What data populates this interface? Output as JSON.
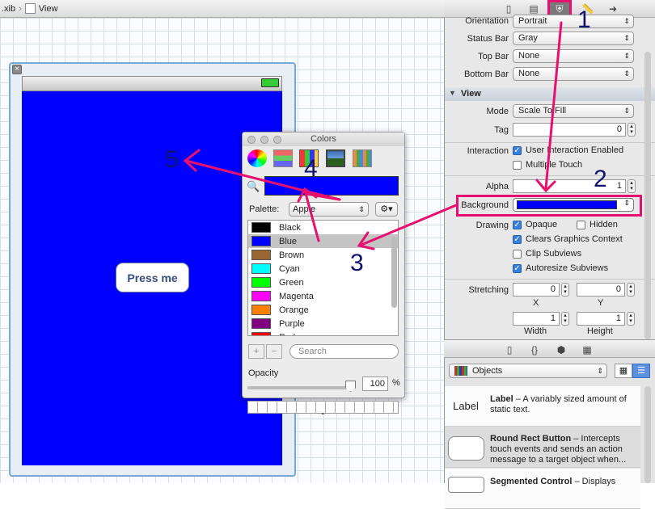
{
  "jumpbar": {
    "file": ".xib",
    "sep": "›",
    "view": "View"
  },
  "canvas": {
    "button_label": "Press me",
    "view_color": "#0000ff",
    "close_glyph": "×"
  },
  "colors_panel": {
    "title": "Colors",
    "palette_label": "Palette:",
    "palette_value": "Apple",
    "selected_color": "#0000ff",
    "colors": [
      {
        "name": "Black",
        "hex": "#000000"
      },
      {
        "name": "Blue",
        "hex": "#0000ff",
        "selected": true
      },
      {
        "name": "Brown",
        "hex": "#996633"
      },
      {
        "name": "Cyan",
        "hex": "#00ffff"
      },
      {
        "name": "Green",
        "hex": "#00ff00"
      },
      {
        "name": "Magenta",
        "hex": "#ff00ff"
      },
      {
        "name": "Orange",
        "hex": "#ff8000"
      },
      {
        "name": "Purple",
        "hex": "#800080"
      },
      {
        "name": "Red",
        "hex": "#ff0000"
      }
    ],
    "search_placeholder": "Search",
    "add_glyph": "+",
    "remove_glyph": "−",
    "opacity_label": "Opacity",
    "opacity_value": "100",
    "opacity_unit": "%",
    "opacity_fraction": 1.0,
    "gear_glyph": "⚙▾",
    "handle_glyph": "⌃"
  },
  "inspector": {
    "tab_icons": [
      "file-icon",
      "quick-help-icon",
      "identity-icon",
      "attributes-icon",
      "size-icon",
      "connections-icon"
    ],
    "orientation_label": "Orientation",
    "orientation_value": "Portrait",
    "statusbar_label": "Status Bar",
    "statusbar_value": "Gray",
    "topbar_label": "Top Bar",
    "topbar_value": "None",
    "bottombar_label": "Bottom Bar",
    "bottombar_value": "None",
    "view_section": "View",
    "mode_label": "Mode",
    "mode_value": "Scale To Fill",
    "tag_label": "Tag",
    "tag_value": "0",
    "interaction_label": "Interaction",
    "user_interaction": "User Interaction Enabled",
    "multiple_touch": "Multiple Touch",
    "alpha_label": "Alpha",
    "alpha_value": "1",
    "background_label": "Background",
    "background_color": "#0000ff",
    "drawing_label": "Drawing",
    "opaque": "Opaque",
    "hidden": "Hidden",
    "clears": "Clears Graphics Context",
    "clip": "Clip Subviews",
    "autoresize": "Autoresize Subviews",
    "stretching_label": "Stretching",
    "stretch_x": "0",
    "stretch_y": "0",
    "stretch_w": "1",
    "stretch_h": "1",
    "x_label": "X",
    "y_label": "Y",
    "width_label": "Width",
    "height_label": "Height",
    "popup_arrow": "⇕"
  },
  "library": {
    "filter_value": "Objects",
    "items": [
      {
        "thumb": "Label",
        "title": "Label",
        "desc": " – A variably sized amount of static text."
      },
      {
        "thumb": "",
        "title": "Round Rect Button",
        "desc": " – Intercepts touch events and sends an action message to a target object when..."
      },
      {
        "thumb": "",
        "title": "Segmented Control",
        "desc": " – Displays"
      }
    ]
  },
  "annotations": {
    "n1": "1",
    "n2": "2",
    "n3": "3",
    "n4": "4",
    "n5": "5",
    "color": "#e8106e"
  }
}
